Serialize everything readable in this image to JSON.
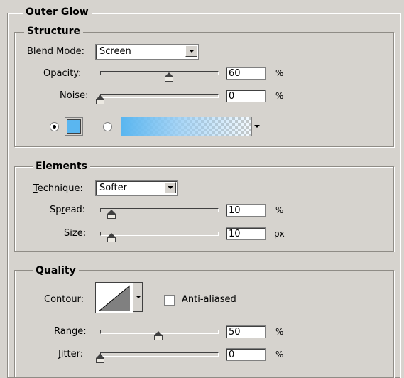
{
  "outer_glow": {
    "title": "Outer Glow"
  },
  "structure": {
    "title": "Structure",
    "blend_mode": {
      "label_mnemonic": "B",
      "label_rest": "lend Mode:",
      "value": "Screen"
    },
    "opacity": {
      "label_mnemonic": "O",
      "label_rest": "pacity:",
      "value": "60",
      "unit": "%",
      "slider_fraction": 0.6
    },
    "noise": {
      "label_mnemonic": "N",
      "label_rest": "oise:",
      "value": "0",
      "unit": "%",
      "slider_fraction": 0.0
    },
    "glow_type": {
      "selected": "solid-color",
      "color": "#5ab6f0",
      "gradient_start": "#5ab6f0"
    }
  },
  "elements": {
    "title": "Elements",
    "technique": {
      "label_mnemonic": "T",
      "label_rest": "echnique:",
      "value": "Softer"
    },
    "spread": {
      "label_pre": "Sp",
      "label_mnemonic": "r",
      "label_rest": "ead:",
      "value": "10",
      "unit": "%",
      "slider_fraction": 0.1
    },
    "size": {
      "label_mnemonic": "S",
      "label_rest": "ize:",
      "value": "10",
      "unit": "px",
      "slider_fraction": 0.04
    }
  },
  "quality": {
    "title": "Quality",
    "contour": {
      "label": "Contour:"
    },
    "anti_aliased": {
      "label_pre": "Anti-a",
      "label_mnemonic": "l",
      "label_rest": "iased",
      "checked": false
    },
    "range": {
      "label_mnemonic": "R",
      "label_rest": "ange:",
      "value": "50",
      "unit": "%",
      "slider_fraction": 0.5
    },
    "jitter": {
      "label_mnemonic": "J",
      "label_rest": "itter:",
      "value": "0",
      "unit": "%",
      "slider_fraction": 0.0
    }
  }
}
